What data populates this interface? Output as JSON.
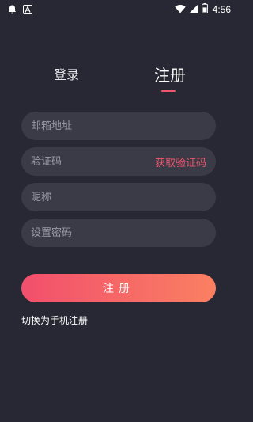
{
  "status_bar": {
    "time": "4:56",
    "battery_level": 0.6,
    "icons": [
      "notification-bell-icon",
      "app-a-icon",
      "wifi-icon",
      "signal-icon",
      "battery-icon"
    ]
  },
  "tabs": [
    {
      "label": "登录",
      "active": false
    },
    {
      "label": "注册",
      "active": true
    }
  ],
  "form": {
    "email_placeholder": "邮箱地址",
    "code_placeholder": "验证码",
    "get_code_label": "获取验证码",
    "nickname_placeholder": "昵称",
    "password_placeholder": "设置密码"
  },
  "register_button": "注册",
  "switch_link": "切换为手机注册",
  "colors": {
    "background": "#272833",
    "field": "#3a3b47",
    "accent": "#f0566d",
    "gradient_start": "#f24f6c",
    "gradient_end": "#fa8062"
  }
}
